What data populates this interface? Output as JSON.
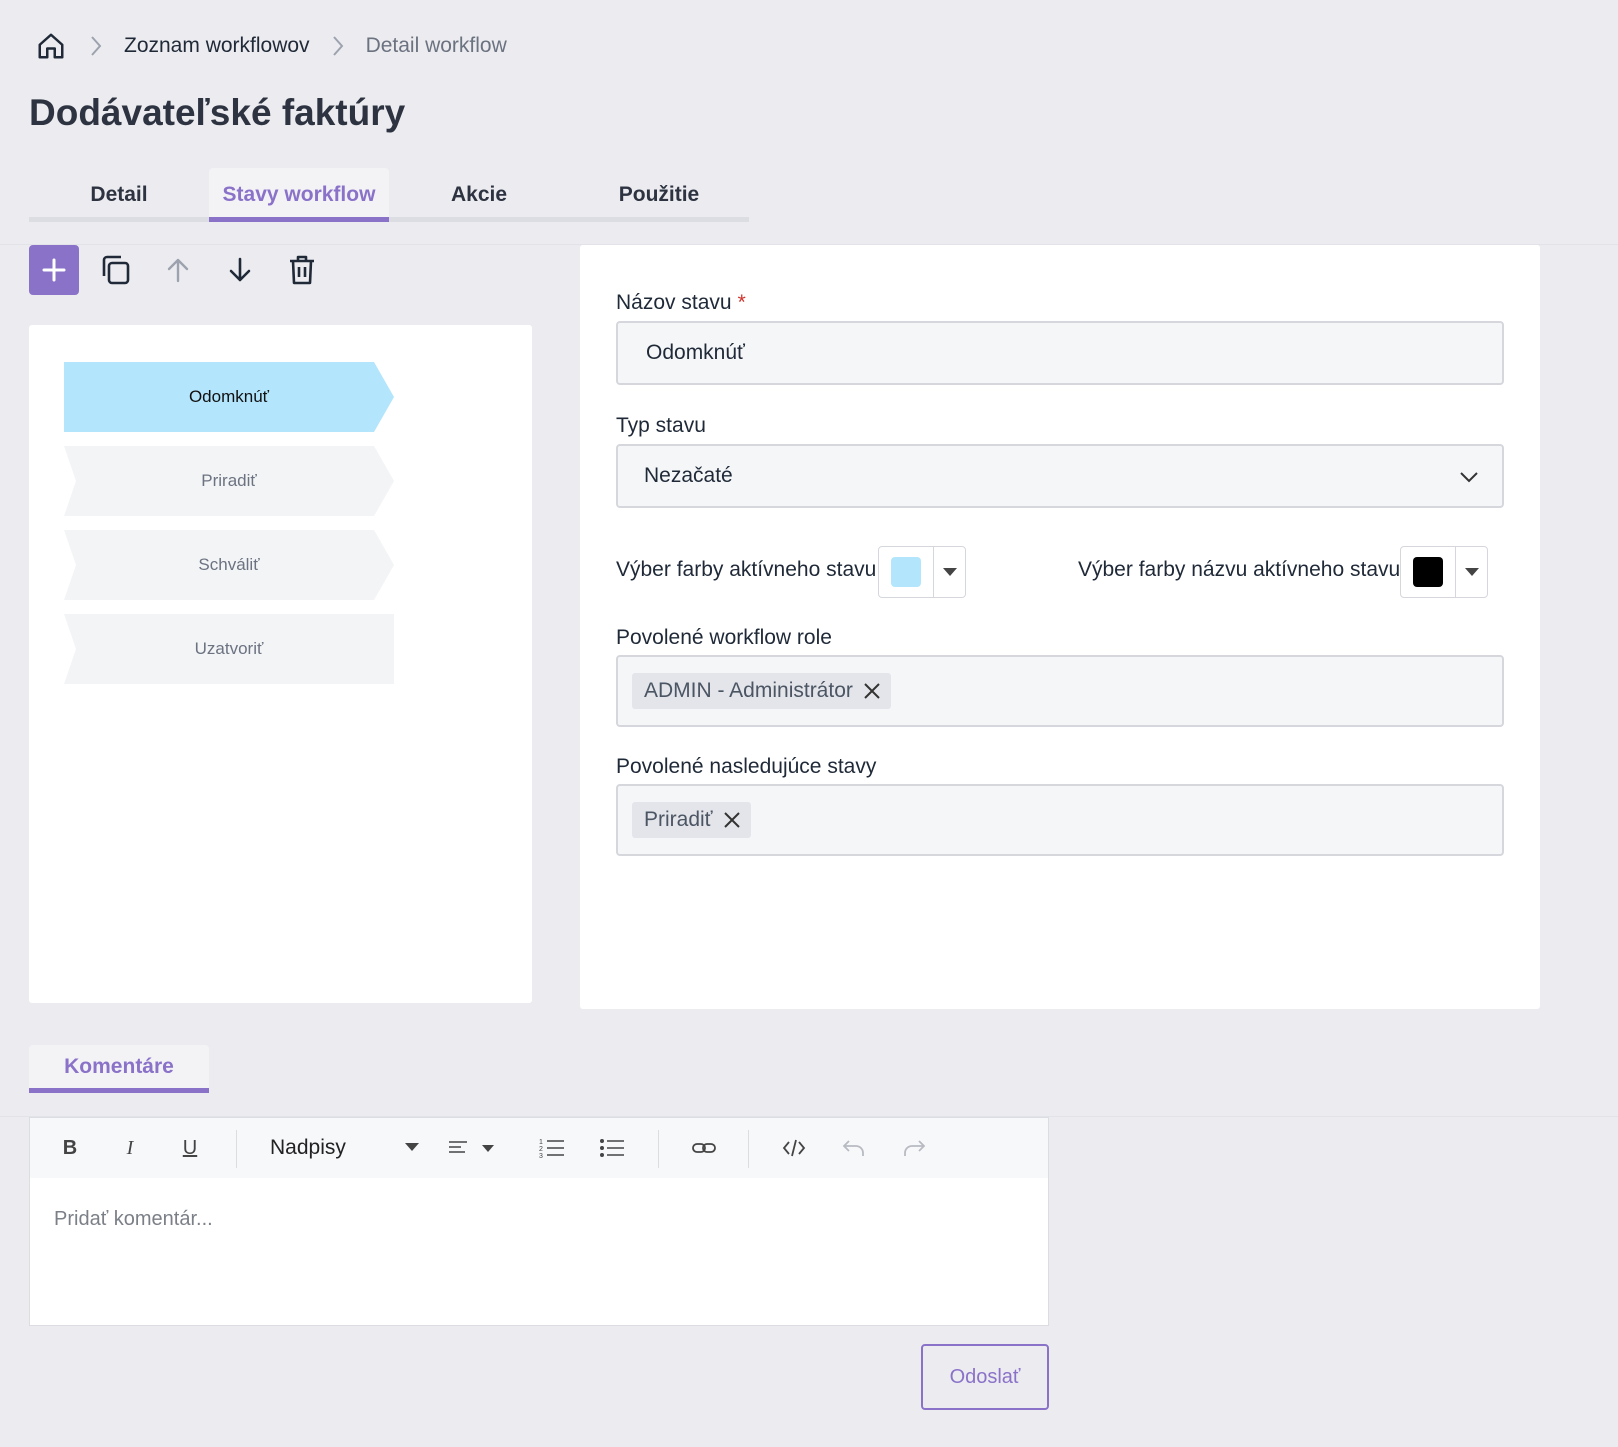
{
  "breadcrumb": {
    "home_icon": "home-icon",
    "items": [
      "Zoznam workflowov",
      "Detail workflow"
    ]
  },
  "page": {
    "title": "Dodávateľské faktúry"
  },
  "tabs": [
    {
      "label": "Detail",
      "active": false
    },
    {
      "label": "Stavy workflow",
      "active": true
    },
    {
      "label": "Akcie",
      "active": false
    },
    {
      "label": "Použitie",
      "active": false
    }
  ],
  "toolbar": {
    "icons": [
      "plus-icon",
      "copy-icon",
      "arrow-up-icon",
      "arrow-down-icon",
      "trash-icon"
    ]
  },
  "states": [
    {
      "label": "Odomknúť",
      "active": true
    },
    {
      "label": "Priradiť",
      "active": false
    },
    {
      "label": "Schváliť",
      "active": false
    },
    {
      "label": "Uzatvoriť",
      "active": false
    }
  ],
  "form": {
    "name_label": "Názov stavu",
    "name_required": "*",
    "name_value": "Odomknúť",
    "type_label": "Typ stavu",
    "type_value": "Nezačaté",
    "active_color_label": "Výber farby aktívneho stavu",
    "active_color": "#b3e5fc",
    "name_color_label": "Výber farby názvu aktívneho stavu",
    "name_color": "#000000",
    "roles_label": "Povolené workflow role",
    "roles": [
      "ADMIN - Administrátor"
    ],
    "next_states_label": "Povolené nasledujúce stavy",
    "next_states": [
      "Priradiť"
    ]
  },
  "comments": {
    "tab_label": "Komentáre",
    "toolbar": {
      "bold": "B",
      "italic": "I",
      "underline": "U",
      "headings": "Nadpisy"
    },
    "placeholder": "Pridať komentár...",
    "send_label": "Odoslať"
  },
  "colors": {
    "accent": "#8a72c9",
    "active_state_fill": "#b3e5fc",
    "inactive_state_fill": "#f3f4f6"
  }
}
